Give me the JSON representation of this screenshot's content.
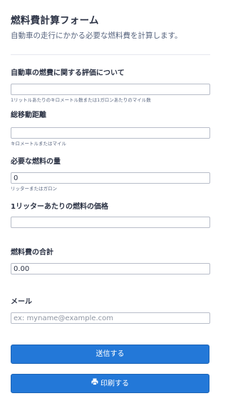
{
  "form": {
    "title": "燃料費計算フォーム",
    "subtitle": "自動車の走行にかかる必要な燃料費を計算します。"
  },
  "fields": {
    "efficiency": {
      "label": "自動車の燃費に関する評価について",
      "value": "",
      "hint": "1リットルあたりのキロメートル数または1ガロンあたりのマイル数"
    },
    "distance": {
      "label": "総移動距離",
      "value": "",
      "hint": "キロメートルまたはマイル"
    },
    "fuel_needed": {
      "label": "必要な燃料の量",
      "value": "0",
      "hint": "リッターまたはガロン"
    },
    "price": {
      "label": "1リッターあたりの燃料の価格",
      "value": ""
    },
    "total": {
      "label": "燃料費の合計",
      "value": "0.00"
    },
    "email": {
      "label": "メール",
      "placeholder": "ex: myname@example.com",
      "value": ""
    }
  },
  "buttons": {
    "submit_label": "送信する",
    "print_label": "印刷する",
    "print_icon": "printer-icon"
  },
  "colors": {
    "button": "#2378d8",
    "text": "#2c3345"
  }
}
